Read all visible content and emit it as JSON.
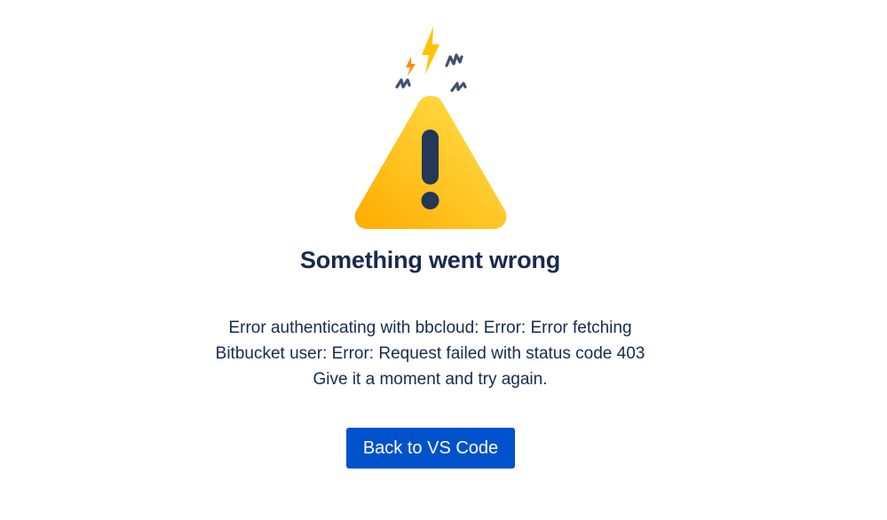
{
  "error": {
    "title": "Something went wrong",
    "message_lines": [
      "Error authenticating with bbcloud: Error: Error fetching",
      "Bitbucket user: Error: Request failed with status code 403",
      "Give it a moment and try again."
    ]
  },
  "actions": {
    "back_label": "Back to VS Code"
  },
  "illustration": {
    "icon": "warning-triangle-icon",
    "colors": {
      "triangle_light": "#ffd740",
      "triangle_dark": "#ffab00",
      "exclamation": "#253858",
      "bolt": "#ffc400",
      "squiggle": "#42526e",
      "button": "#0052cc"
    }
  }
}
